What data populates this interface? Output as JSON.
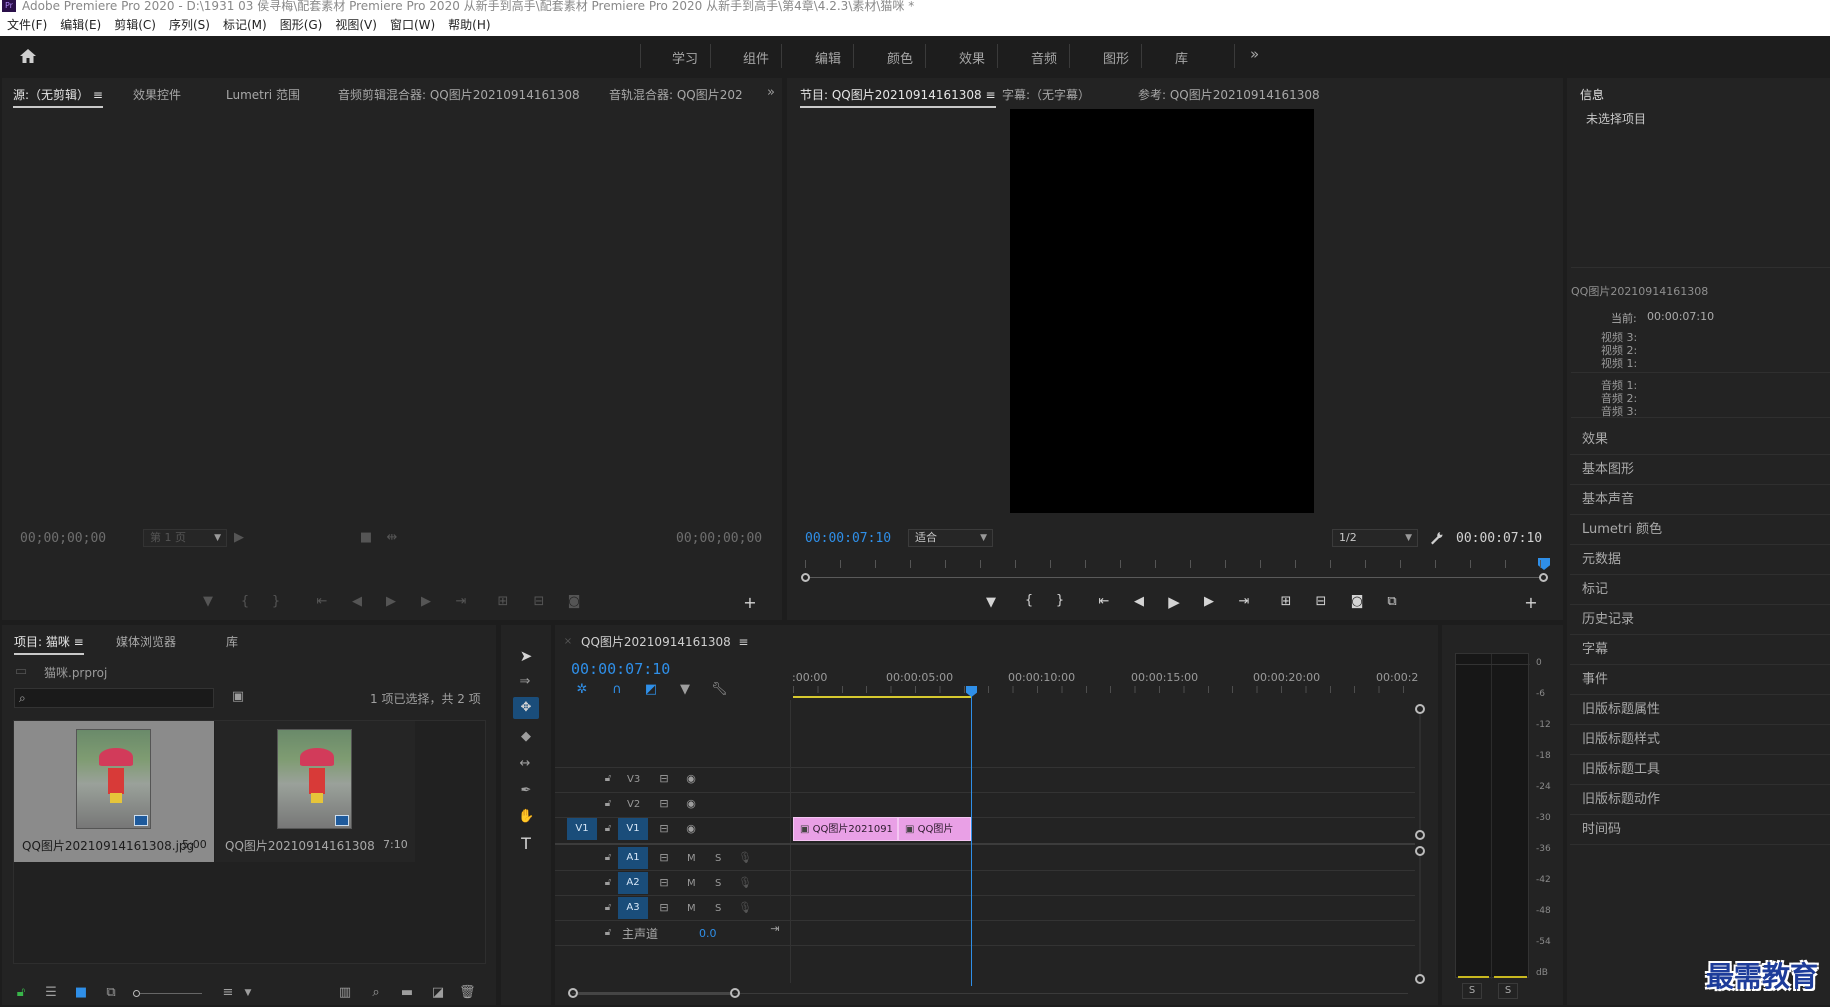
{
  "window": {
    "title": "Adobe Premiere Pro 2020 - D:\\1931 03 侯寻梅\\配套素材 Premiere Pro 2020 从新手到高手\\配套素材 Premiere Pro 2020 从新手到高手\\第4章\\4.2.3\\素材\\猫咪 *",
    "app_badge": "Pr"
  },
  "menu": [
    "文件(F)",
    "编辑(E)",
    "剪辑(C)",
    "序列(S)",
    "标记(M)",
    "图形(G)",
    "视图(V)",
    "窗口(W)",
    "帮助(H)"
  ],
  "workspaces": [
    "学习",
    "组件",
    "编辑",
    "颜色",
    "效果",
    "音频",
    "图形",
    "库"
  ],
  "source_panel": {
    "tabs": [
      "源:（无剪辑）",
      "效果控件",
      "Lumetri 范围",
      "音频剪辑混合器: QQ图片20210914161308",
      "音轨混合器: QQ图片202"
    ],
    "timecode_left": "00;00;00;00",
    "timecode_right": "00;00;00;00",
    "page_select": "第 1 页"
  },
  "program_panel": {
    "tabs": [
      "节目: QQ图片20210914161308",
      "字幕:（无字幕）",
      "参考: QQ图片20210914161308"
    ],
    "timecode_left": "00:00:07:10",
    "timecode_right": "00:00:07:10",
    "fit_select": "适合",
    "quality_select": "1/2"
  },
  "info_panel": {
    "title": "信息",
    "no_selection": "未选择项目",
    "sequence_name": "QQ图片20210914161308",
    "current_label": "当前:",
    "current_value": "00:00:07:10",
    "video_tracks": [
      "视频 3:",
      "视频 2:",
      "视频 1:"
    ],
    "audio_tracks": [
      "音频 1:",
      "音频 2:",
      "音频 3:"
    ],
    "items": [
      "效果",
      "基本图形",
      "基本声音",
      "Lumetri 颜色",
      "元数据",
      "标记",
      "历史记录",
      "字幕",
      "事件",
      "旧版标题属性",
      "旧版标题样式",
      "旧版标题工具",
      "旧版标题动作",
      "时间码"
    ]
  },
  "project_panel": {
    "tabs": [
      "项目: 猫咪",
      "媒体浏览器",
      "库"
    ],
    "project_file": "猫咪.prproj",
    "search_placeholder": "",
    "selection_status": "1 项已选择，共 2 项",
    "items": [
      {
        "name": "QQ图片20210914161308.jpg",
        "duration": "5:00"
      },
      {
        "name": "QQ图片20210914161308",
        "duration": "7:10"
      }
    ]
  },
  "timeline": {
    "tab": "QQ图片20210914161308",
    "timecode": "00:00:07:10",
    "ruler": [
      ":00:00",
      "00:00:05:00",
      "00:00:10:00",
      "00:00:15:00",
      "00:00:20:00",
      "00:00:2"
    ],
    "video_tracks": [
      "V3",
      "V2",
      "V1"
    ],
    "audio_tracks": [
      "A1",
      "A2",
      "A3"
    ],
    "source_patch": "V1",
    "master_label": "主声道",
    "master_value": "0.0",
    "mute_label": "M",
    "solo_label": "S",
    "clips": [
      "QQ图片2021091",
      "QQ图片"
    ]
  },
  "meter": {
    "scale": [
      "0",
      "-6",
      "-12",
      "-18",
      "-24",
      "-30",
      "-36",
      "-42",
      "-48",
      "-54",
      "dB"
    ],
    "solo_buttons": [
      "S",
      "S"
    ]
  },
  "watermark": "最需教育"
}
